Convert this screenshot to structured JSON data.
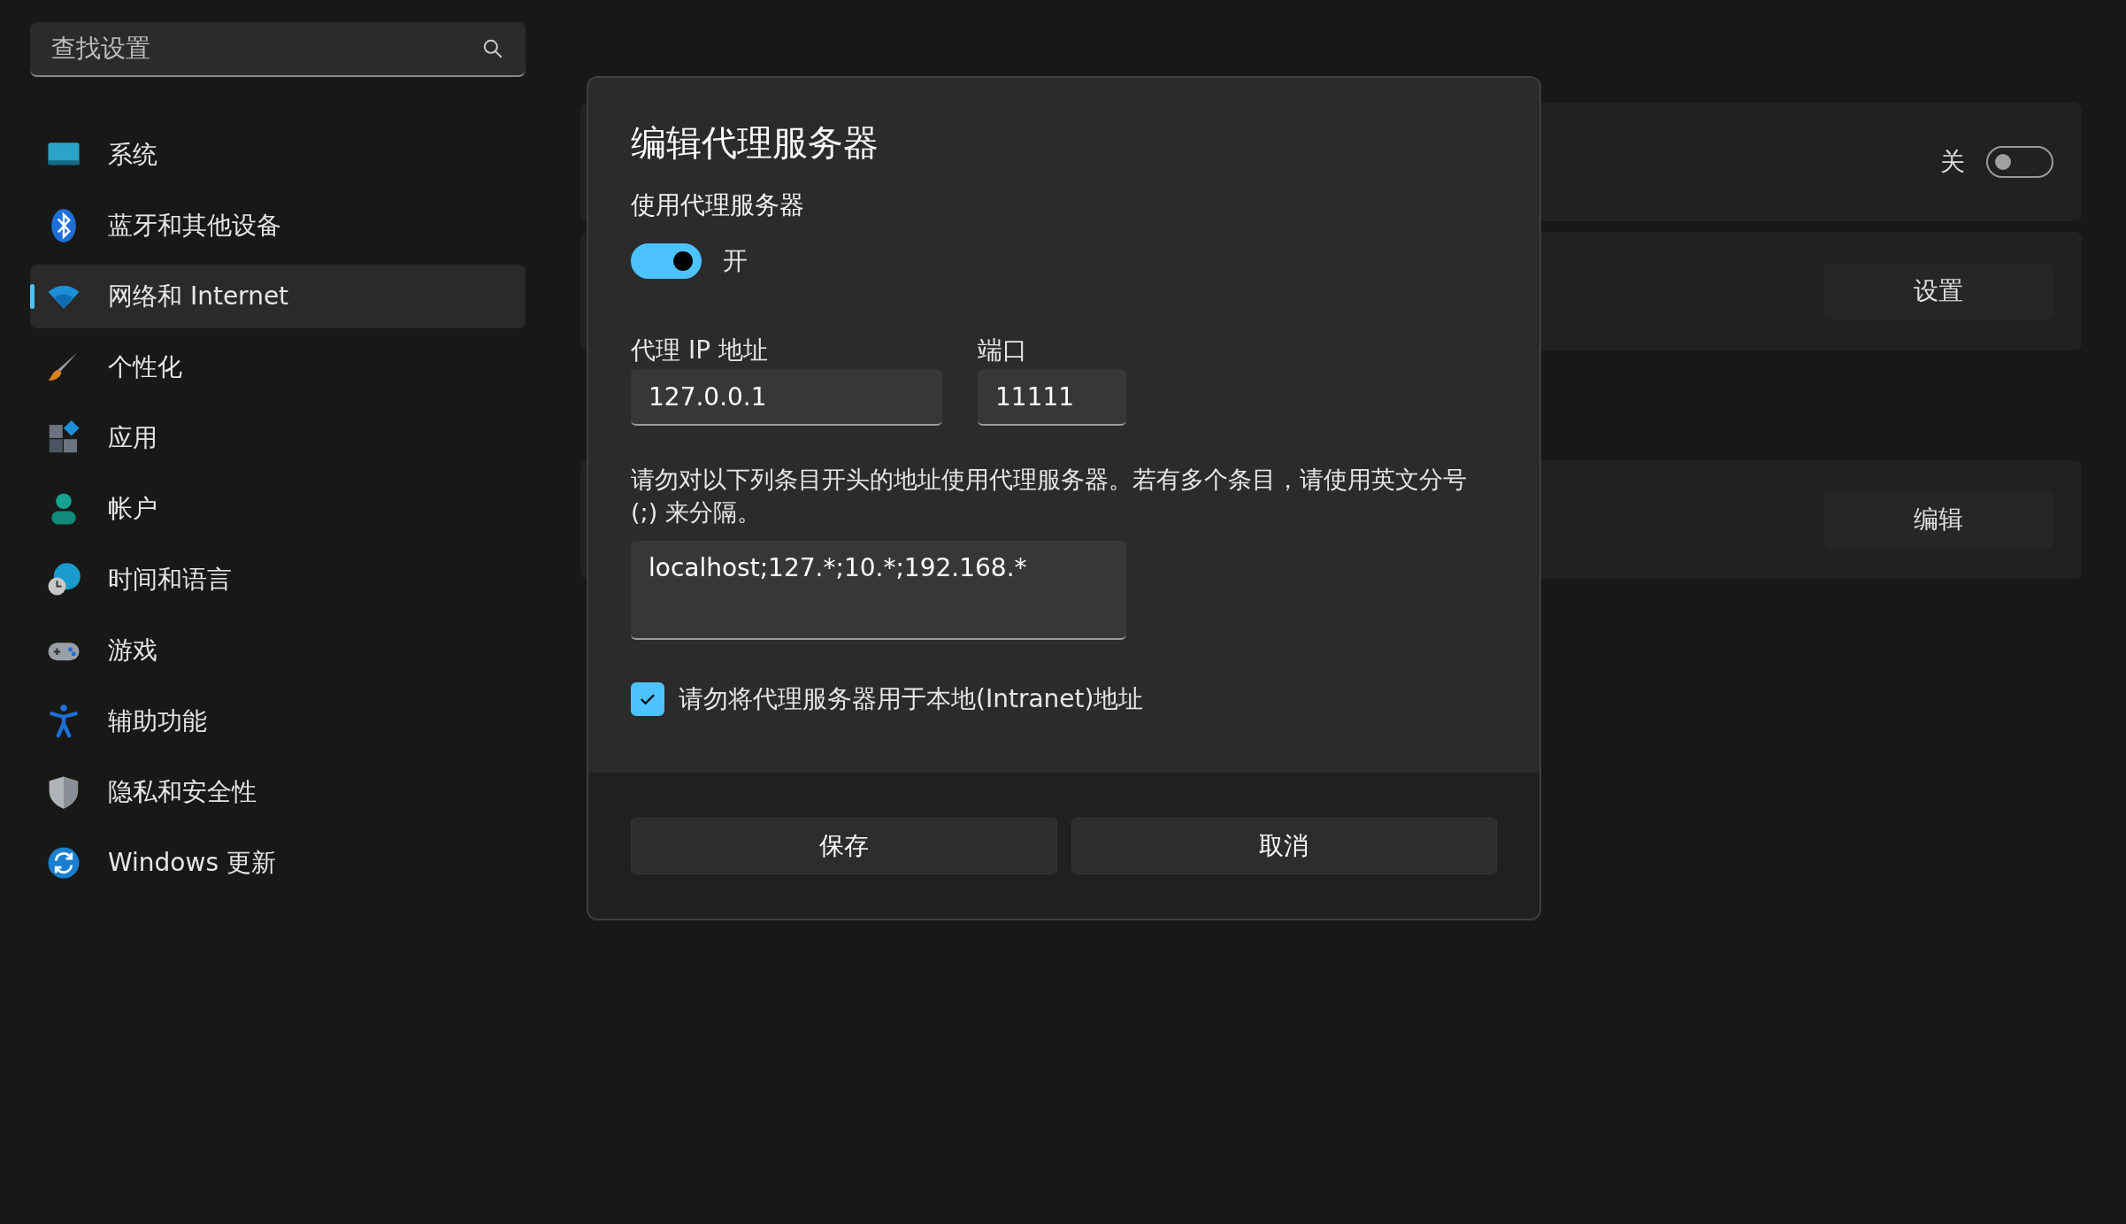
{
  "search": {
    "placeholder": "查找设置"
  },
  "sidebar": {
    "items": [
      {
        "label": "系统",
        "kind": "system",
        "selected": false
      },
      {
        "label": "蓝牙和其他设备",
        "kind": "bluetooth",
        "selected": false
      },
      {
        "label": "网络和 Internet",
        "kind": "network",
        "selected": true
      },
      {
        "label": "个性化",
        "kind": "brush",
        "selected": false
      },
      {
        "label": "应用",
        "kind": "apps",
        "selected": false
      },
      {
        "label": "帐户",
        "kind": "account",
        "selected": false
      },
      {
        "label": "时间和语言",
        "kind": "time",
        "selected": false
      },
      {
        "label": "游戏",
        "kind": "gaming",
        "selected": false
      },
      {
        "label": "辅助功能",
        "kind": "accessibility",
        "selected": false
      },
      {
        "label": "隐私和安全性",
        "kind": "privacy",
        "selected": false
      },
      {
        "label": "Windows 更新",
        "kind": "update",
        "selected": false
      }
    ]
  },
  "content": {
    "cards": [
      {
        "kind": "toggle",
        "label": "关",
        "on": false
      },
      {
        "kind": "button",
        "label": "设置"
      },
      {
        "kind": "button",
        "label": "编辑"
      }
    ]
  },
  "dialog": {
    "title": "编辑代理服务器",
    "toggle_heading": "使用代理服务器",
    "toggle": {
      "on": true,
      "label": "开"
    },
    "ip_field": {
      "label": "代理 IP 地址",
      "value": "127.0.0.1"
    },
    "port_field": {
      "label": "端口",
      "value": "11111"
    },
    "description": "请勿对以下列条目开头的地址使用代理服务器。若有多个条目，请使用英文分号 (;) 来分隔。",
    "exceptions": {
      "value": "localhost;127.*;10.*;192.168.*"
    },
    "checkbox": {
      "label": "请勿将代理服务器用于本地(Intranet)地址",
      "checked": true
    },
    "buttons": [
      "保存",
      "取消"
    ]
  }
}
